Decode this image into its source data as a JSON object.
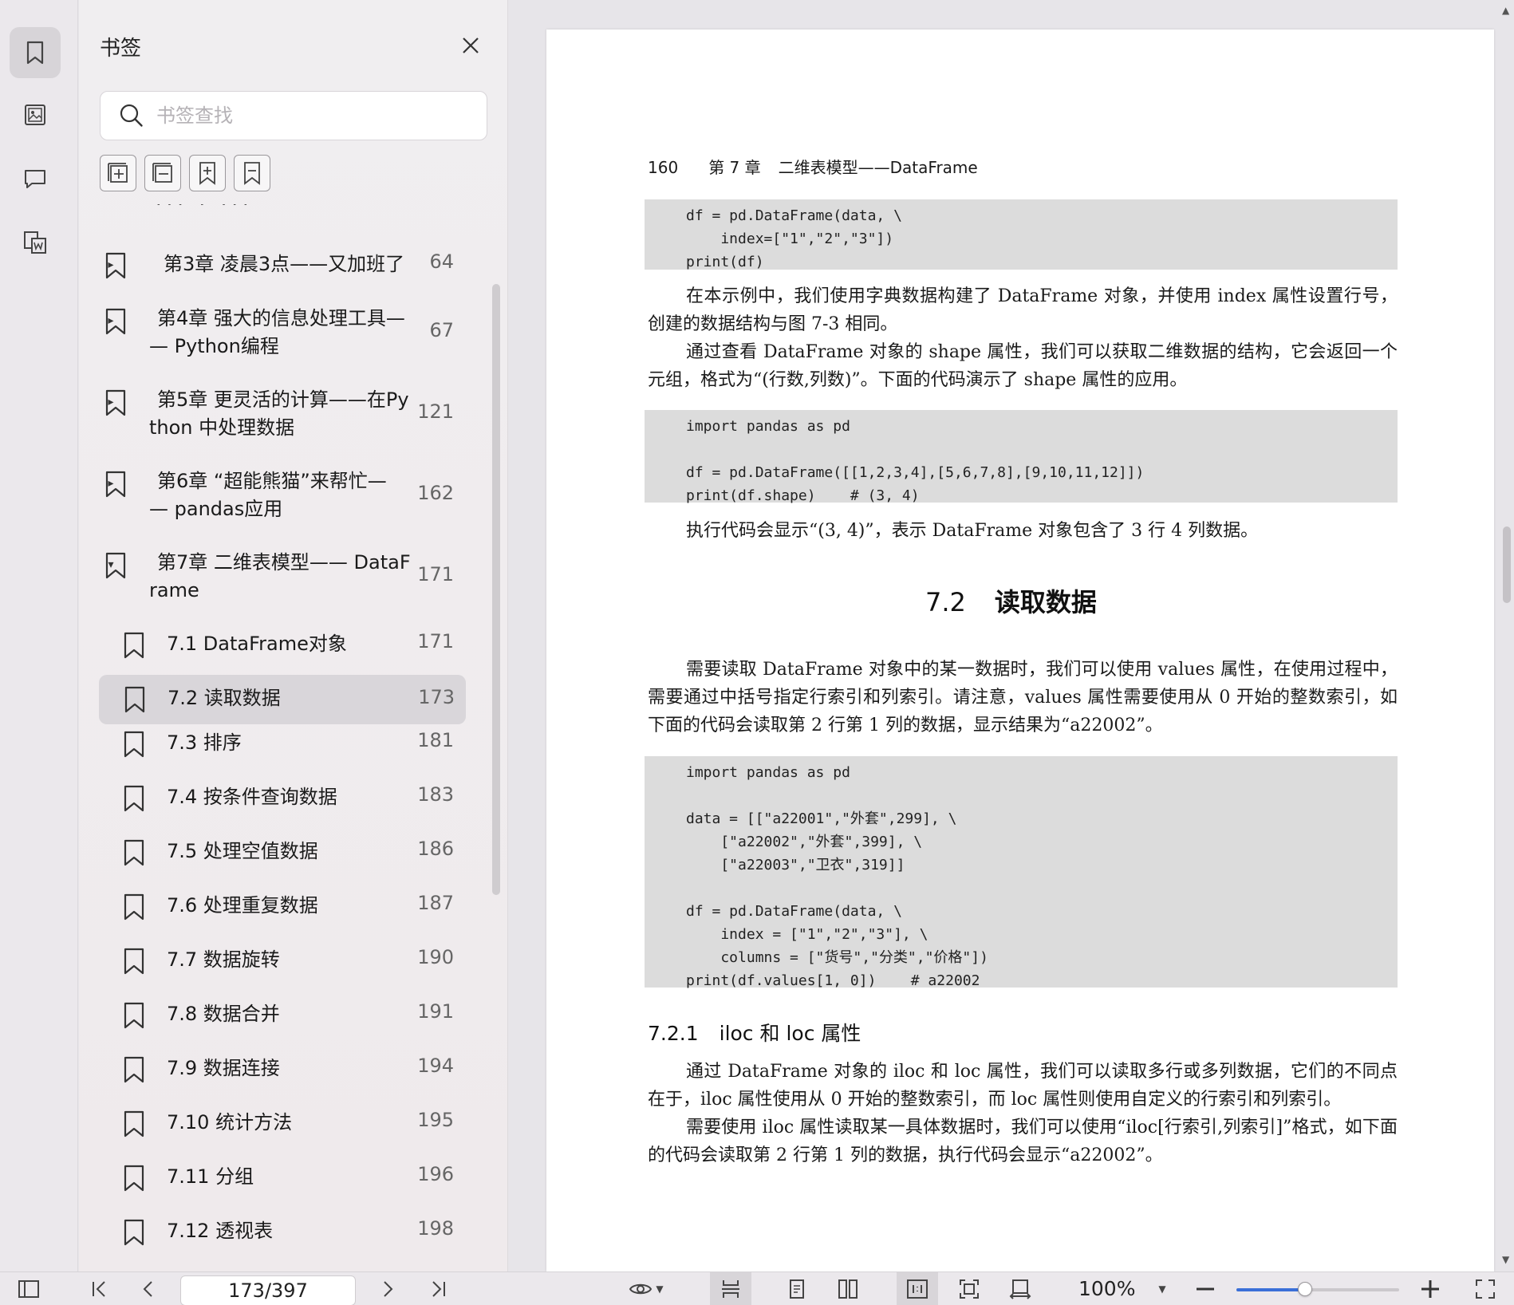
{
  "rail": {
    "items": [
      {
        "name": "bookmark",
        "icon": "bookmark-icon",
        "active": true
      },
      {
        "name": "thumbnails",
        "icon": "image-icon"
      },
      {
        "name": "comments",
        "icon": "comment-icon"
      },
      {
        "name": "word-export",
        "icon": "word-export-icon"
      }
    ]
  },
  "panel": {
    "title": "书签",
    "search_placeholder": "书签查找",
    "toolbar": [
      "expand-all-icon",
      "collapse-all-icon",
      "add-bookmark-icon",
      "remove-bookmark-icon"
    ],
    "clipped_top": "··· · ···",
    "bookmarks": [
      {
        "label": "第3章 凌晨3点——又加班了",
        "page": "64",
        "level": 1,
        "caret": "▸"
      },
      {
        "label": "第4章 强大的信息处理工具—\n— Python编程",
        "page": "67",
        "level": 1,
        "caret": "▸"
      },
      {
        "label": "第5章 更灵活的计算——在Py\nthon 中处理数据",
        "page": "121",
        "level": 1,
        "caret": "▸"
      },
      {
        "label": "第6章 “超能熊猫”来帮忙—\n— pandas应用",
        "page": "162",
        "level": 1,
        "caret": "▸"
      },
      {
        "label": "第7章 二维表模型—— DataF\nrame",
        "page": "171",
        "level": 1,
        "caret": "▾"
      },
      {
        "label": "7.1 DataFrame对象",
        "page": "171",
        "level": 2
      },
      {
        "label": "7.2 读取数据",
        "page": "173",
        "level": 2,
        "selected": true
      },
      {
        "label": "7.3 排序",
        "page": "181",
        "level": 2
      },
      {
        "label": "7.4 按条件查询数据",
        "page": "183",
        "level": 2
      },
      {
        "label": "7.5 处理空值数据",
        "page": "186",
        "level": 2
      },
      {
        "label": "7.6 处理重复数据",
        "page": "187",
        "level": 2
      },
      {
        "label": "7.7 数据旋转",
        "page": "190",
        "level": 2
      },
      {
        "label": "7.8 数据合并",
        "page": "191",
        "level": 2
      },
      {
        "label": "7.9 数据连接",
        "page": "194",
        "level": 2
      },
      {
        "label": "7.10 统计方法",
        "page": "195",
        "level": 2
      },
      {
        "label": "7.11 分组",
        "page": "196",
        "level": 2
      },
      {
        "label": "7.12 透视表",
        "page": "198",
        "level": 2
      }
    ]
  },
  "document": {
    "running_head": {
      "page_no": "160",
      "chapter": "第 7 章",
      "title": "二维表模型——DataFrame"
    },
    "code1": "df = pd.DataFrame(data, \\\n    index=[\"1\",\"2\",\"3\"])\nprint(df)",
    "para1": [
      "在本示例中，我们使用字典数据构建了 DataFrame 对象，并使用 index 属性设置行号，创建的数据结构与图 7-3 相同。",
      "通过查看 DataFrame 对象的 shape 属性，我们可以获取二维数据的结构，它会返回一个元组，格式为“(行数,列数)”。下面的代码演示了 shape 属性的应用。"
    ],
    "code2": "import pandas as pd\n\ndf = pd.DataFrame([[1,2,3,4],[5,6,7,8],[9,10,11,12]])\nprint(df.shape)    # (3, 4)",
    "para2": [
      "执行代码会显示“(3, 4)”，表示 DataFrame 对象包含了 3 行 4 列数据。"
    ],
    "section": {
      "num": "7.2",
      "title": "读取数据"
    },
    "para3": [
      "需要读取 DataFrame 对象中的某一数据时，我们可以使用 values 属性，在使用过程中，需要通过中括号指定行索引和列索引。请注意，values 属性需要使用从 0 开始的整数索引，如下面的代码会读取第 2 行第 1 列的数据，显示结果为“a22002”。"
    ],
    "code3": "import pandas as pd\n\ndata = [[\"a22001\",\"外套\",299], \\\n    [\"a22002\",\"外套\",399], \\\n    [\"a22003\",\"卫衣\",319]]\n\ndf = pd.DataFrame(data, \\\n    index = [\"1\",\"2\",\"3\"], \\\n    columns = [\"货号\",\"分类\",\"价格\"])\nprint(df.values[1, 0])    # a22002",
    "subsection": {
      "num": "7.2.1",
      "title": "iloc 和 loc 属性"
    },
    "para4": [
      "通过 DataFrame 对象的 iloc 和 loc 属性，我们可以读取多行或多列数据，它们的不同点在于，iloc 属性使用从 0 开始的整数索引，而 loc 属性则使用自定义的行索引和列索引。",
      "需要使用 iloc 属性读取某一具体数据时，我们可以使用“iloc[行索引,列索引]”格式，如下面的代码会读取第 2 行第 1 列的数据，执行代码会显示“a22002”。"
    ]
  },
  "statusbar": {
    "page_indicator": "173/397",
    "zoom": "100%",
    "zoom_level": 0.42,
    "accent": "#3a6fd8"
  }
}
